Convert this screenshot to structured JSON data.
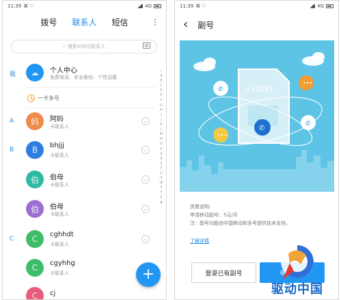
{
  "status_left": {
    "time": "11:39",
    "network": "4G"
  },
  "status_right": {
    "time": "11:39",
    "network": "4G"
  },
  "tabs": [
    {
      "label": "拨号",
      "active": false
    },
    {
      "label": "联系人",
      "active": true
    },
    {
      "label": "短信",
      "active": false
    }
  ],
  "more_label": "⋮",
  "search": {
    "placeholder": "搜索499位联系人"
  },
  "me": {
    "letter": "我",
    "name": "个人中心",
    "sub": "免费电话、安全备份、个性设置"
  },
  "yika": {
    "label": "一卡多号"
  },
  "contacts": [
    {
      "letter": "A",
      "avatar": "妈",
      "name": "阿妈",
      "sub": "卡联系人",
      "color": "#ef8a49"
    },
    {
      "letter": "B",
      "avatar": "B",
      "name": "bhjjj",
      "sub": "卡联系人",
      "color": "#2f7de1"
    },
    {
      "letter": "",
      "avatar": "伯",
      "name": "伯母",
      "sub": "卡联系人",
      "color": "#2fb9a4"
    },
    {
      "letter": "",
      "avatar": "伯",
      "name": "伯母",
      "sub": "卡联系人",
      "color": "#9b6fd1"
    },
    {
      "letter": "C",
      "avatar": "C",
      "name": "cghhdt",
      "sub": "卡联系人",
      "color": "#3dbd67"
    },
    {
      "letter": "",
      "avatar": "C",
      "name": "cgyhhg",
      "sub": "卡联系人",
      "color": "#3dbd67"
    },
    {
      "letter": "",
      "avatar": "C",
      "name": "cj",
      "sub": "",
      "color": "#e85b7a"
    }
  ],
  "alphabet": [
    "☆",
    "A",
    "B",
    "C",
    "D",
    "E",
    "F",
    "G",
    "H",
    "I",
    "J",
    "K",
    "L",
    "M",
    "N",
    "O",
    "P",
    "Q",
    "R",
    "S",
    "T",
    "U",
    "V",
    "W",
    "X",
    "Y",
    "Z",
    "#"
  ],
  "fab_label": "+",
  "right": {
    "back": "‹",
    "title": "副号",
    "banner_number": "+12583",
    "info_title": "资费说明:",
    "info_lines": [
      "申请移动副号：5元/月",
      "注：副号功能由中国移动和多号提供技术支持。"
    ],
    "detail_link": "了解详情",
    "btn_login": "登录已有副号",
    "btn_apply": "申请副号"
  },
  "watermark_text": "驱动中国",
  "colors": {
    "accent": "#2196f3",
    "banner": "#5ec4e6",
    "me_avatar": "#2196f3"
  }
}
